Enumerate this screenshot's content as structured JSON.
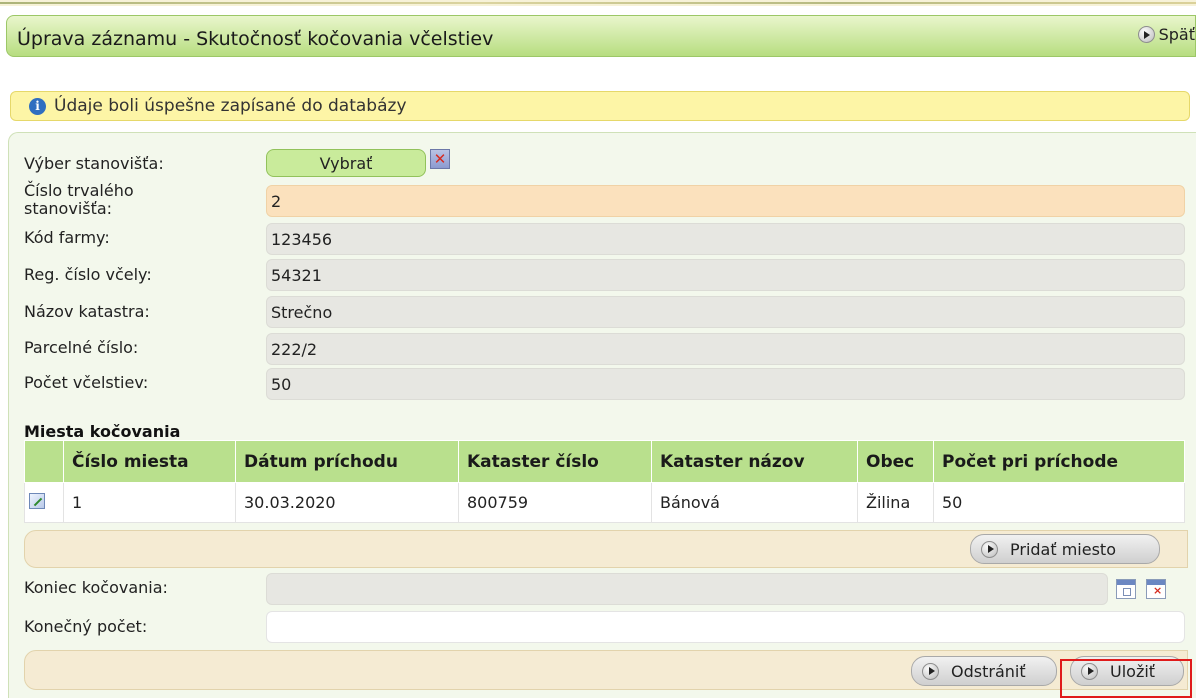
{
  "header": {
    "title": "Úprava záznamu - Skutočnosť kočovania včelstiev",
    "back_label": "Späť"
  },
  "notice": {
    "icon": "info-icon",
    "message": "Údaje boli úspešne zapísané do databázy"
  },
  "form": {
    "vyber_label": "Výber stanovišťa:",
    "vyber_button": "Vybrať",
    "fields": [
      {
        "label": "Číslo trvalého stanovišťa:",
        "value": "2"
      },
      {
        "label": "Kód farmy:",
        "value": "123456"
      },
      {
        "label": "Reg. číslo včely:",
        "value": "54321"
      },
      {
        "label": "Názov katastra:",
        "value": "Strečno"
      },
      {
        "label": "Parcelné číslo:",
        "value": "222/2"
      },
      {
        "label": "Počet včelstiev:",
        "value": "50"
      }
    ]
  },
  "miesta": {
    "title": "Miesta kočovania",
    "columns": [
      "Číslo miesta",
      "Dátum príchodu",
      "Kataster číslo",
      "Kataster názov",
      "Obec",
      "Počet pri príchode"
    ],
    "rows": [
      [
        "1",
        "30.03.2020",
        "800759",
        "Bánová",
        "Žilina",
        "50"
      ]
    ],
    "add_button": "Pridať miesto"
  },
  "end": {
    "koniec_label": "Koniec kočovania:",
    "koniec_value": "",
    "konecny_label": "Konečný počet:",
    "konecny_value": ""
  },
  "actions": {
    "remove_label": "Odstrániť",
    "save_label": "Uložiť"
  },
  "colors": {
    "title_green": "#b7dd80",
    "table_header": "#b9e08d",
    "notice_yellow": "#fdf5a6",
    "beige_bar": "#f5ebd3",
    "highlight_red": "#e01b1b"
  }
}
